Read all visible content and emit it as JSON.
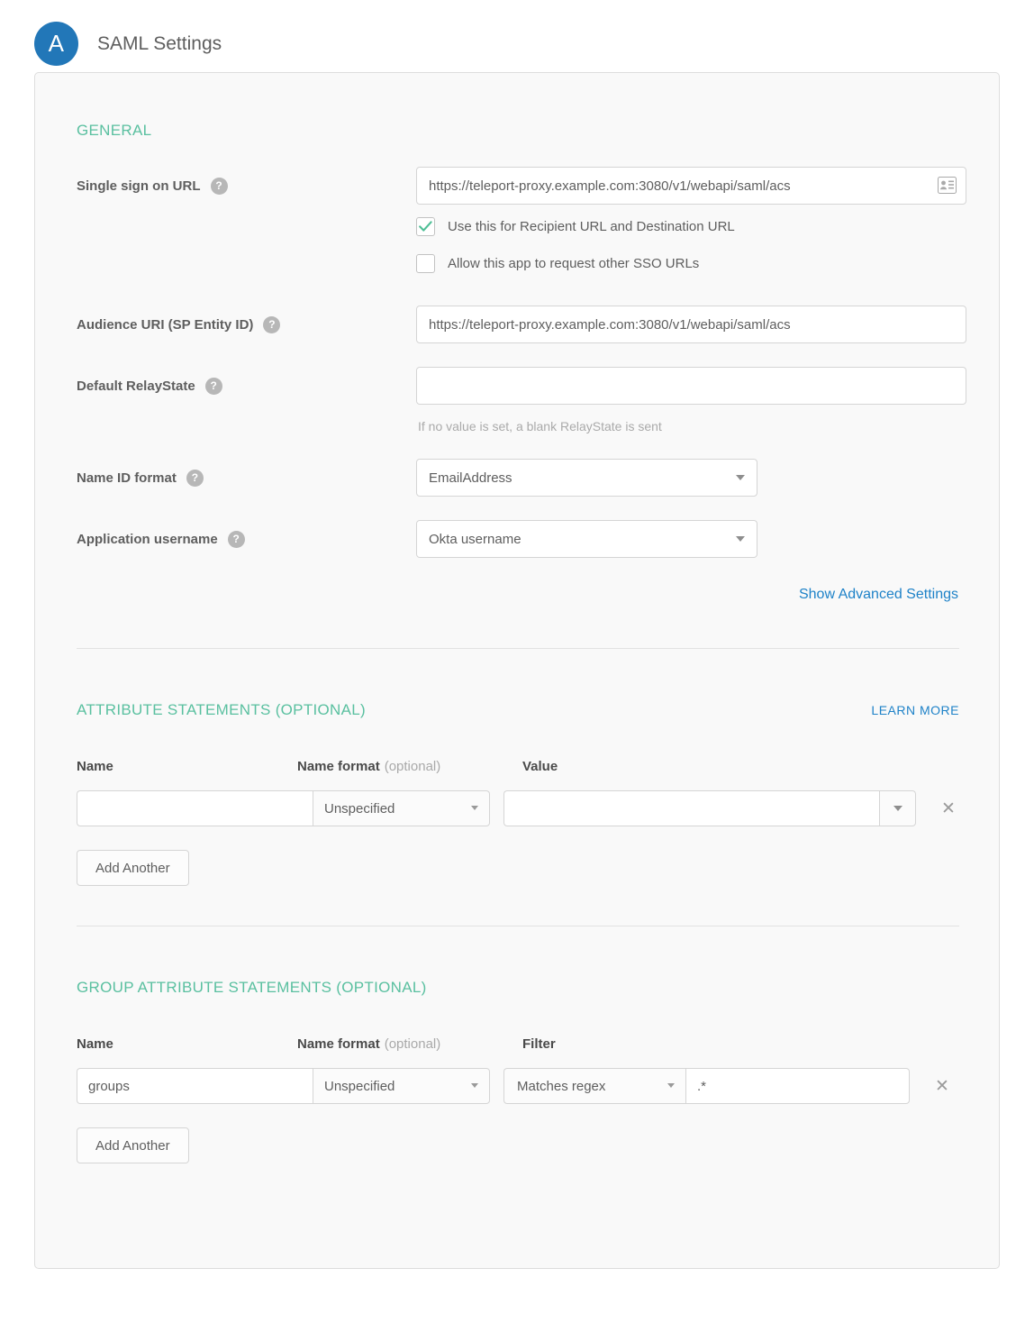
{
  "header": {
    "avatar_letter": "A",
    "title": "SAML Settings"
  },
  "general": {
    "section_title": "GENERAL",
    "single_sign_on": {
      "label": "Single sign on URL",
      "value": "https://teleport-proxy.example.com:3080/v1/webapi/saml/acs",
      "placeholder": "",
      "icon": "contact-card-icon",
      "help_glyph": "?"
    },
    "checkbox_recipient": {
      "label": "Use this for Recipient URL and Destination URL",
      "checked": true,
      "check_glyph": "✓"
    },
    "checkbox_other_sso": {
      "label": "Allow this app to request other SSO URLs",
      "checked": false
    },
    "audience_uri": {
      "label": "Audience URI (SP Entity ID)",
      "value": "https://teleport-proxy.example.com:3080/v1/webapi/saml/acs"
    },
    "default_relay_state": {
      "label": "Default RelayState",
      "value": "",
      "hint": "If no value is set, a blank RelayState is sent"
    },
    "name_id_format": {
      "label": "Name ID format",
      "value": "EmailAddress"
    },
    "application_username": {
      "label": "Application username",
      "value": "Okta username"
    },
    "show_advanced": "Show Advanced Settings"
  },
  "attribute_statements": {
    "section_title": "ATTRIBUTE STATEMENTS (OPTIONAL)",
    "learn_more": "LEARN MORE",
    "columns": {
      "name": "Name",
      "name_format": "Name format",
      "optional": "(optional)",
      "value": "Value"
    },
    "rows": [
      {
        "name": "",
        "name_placeholder": "",
        "name_format": "Unspecified",
        "value": "",
        "value_placeholder": "",
        "remove_glyph": "✕"
      }
    ],
    "add_another": "Add Another"
  },
  "group_attribute_statements": {
    "section_title": "GROUP ATTRIBUTE STATEMENTS (OPTIONAL)",
    "columns": {
      "name": "Name",
      "name_format": "Name format",
      "optional": "(optional)",
      "filter": "Filter"
    },
    "rows": [
      {
        "name": "groups",
        "name_format": "Unspecified",
        "filter_type": "Matches regex",
        "filter_value": ".*",
        "remove_glyph": "✕"
      }
    ],
    "add_another": "Add Another"
  },
  "colors": {
    "avatar_blue": "#2277b8",
    "section_green": "#5ac0a0",
    "link_blue": "#1e82c8",
    "check_green": "#4fbf96",
    "panel_bg": "#f9f9f9",
    "border": "#dddddd"
  }
}
